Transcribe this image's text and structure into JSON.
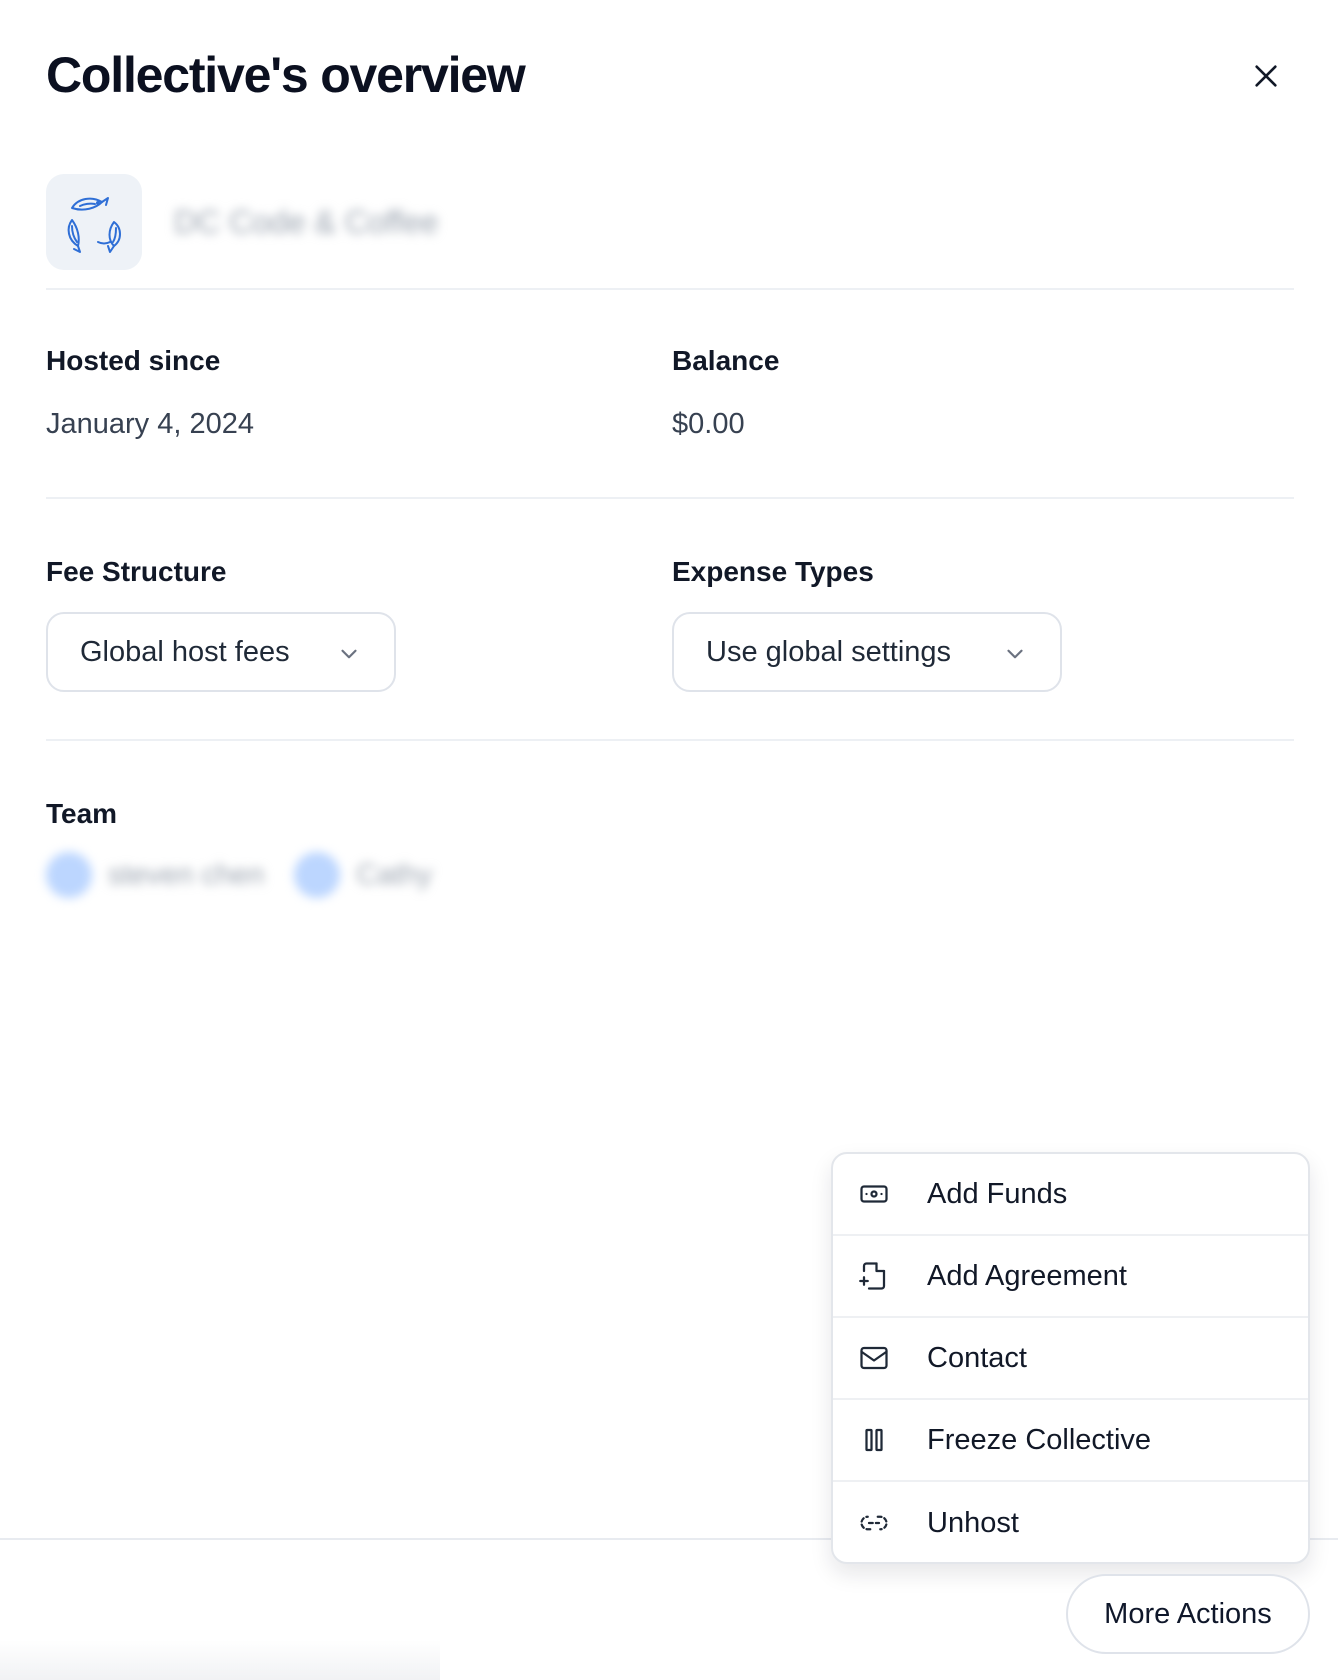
{
  "header": {
    "title": "Collective's overview"
  },
  "collective": {
    "name": "DC Code & Coffee"
  },
  "details": {
    "hosted_since_label": "Hosted since",
    "hosted_since_value": "January 4, 2024",
    "balance_label": "Balance",
    "balance_value": "$0.00"
  },
  "settings": {
    "fee_label": "Fee Structure",
    "fee_value": "Global host fees",
    "expense_label": "Expense Types",
    "expense_value": "Use global settings"
  },
  "team": {
    "label": "Team",
    "members": [
      "steven chen",
      "Cathy"
    ]
  },
  "menu": {
    "items": [
      {
        "label": "Add Funds",
        "icon": "money-icon"
      },
      {
        "label": "Add Agreement",
        "icon": "file-plus-icon"
      },
      {
        "label": "Contact",
        "icon": "mail-icon"
      },
      {
        "label": "Freeze Collective",
        "icon": "pause-icon"
      },
      {
        "label": "Unhost",
        "icon": "unlink-icon"
      }
    ]
  },
  "footer": {
    "more_actions_label": "More Actions"
  },
  "colors": {
    "accent_blue": "#2563eb",
    "text_dark": "#0f172a",
    "border": "#dfe3ea"
  }
}
